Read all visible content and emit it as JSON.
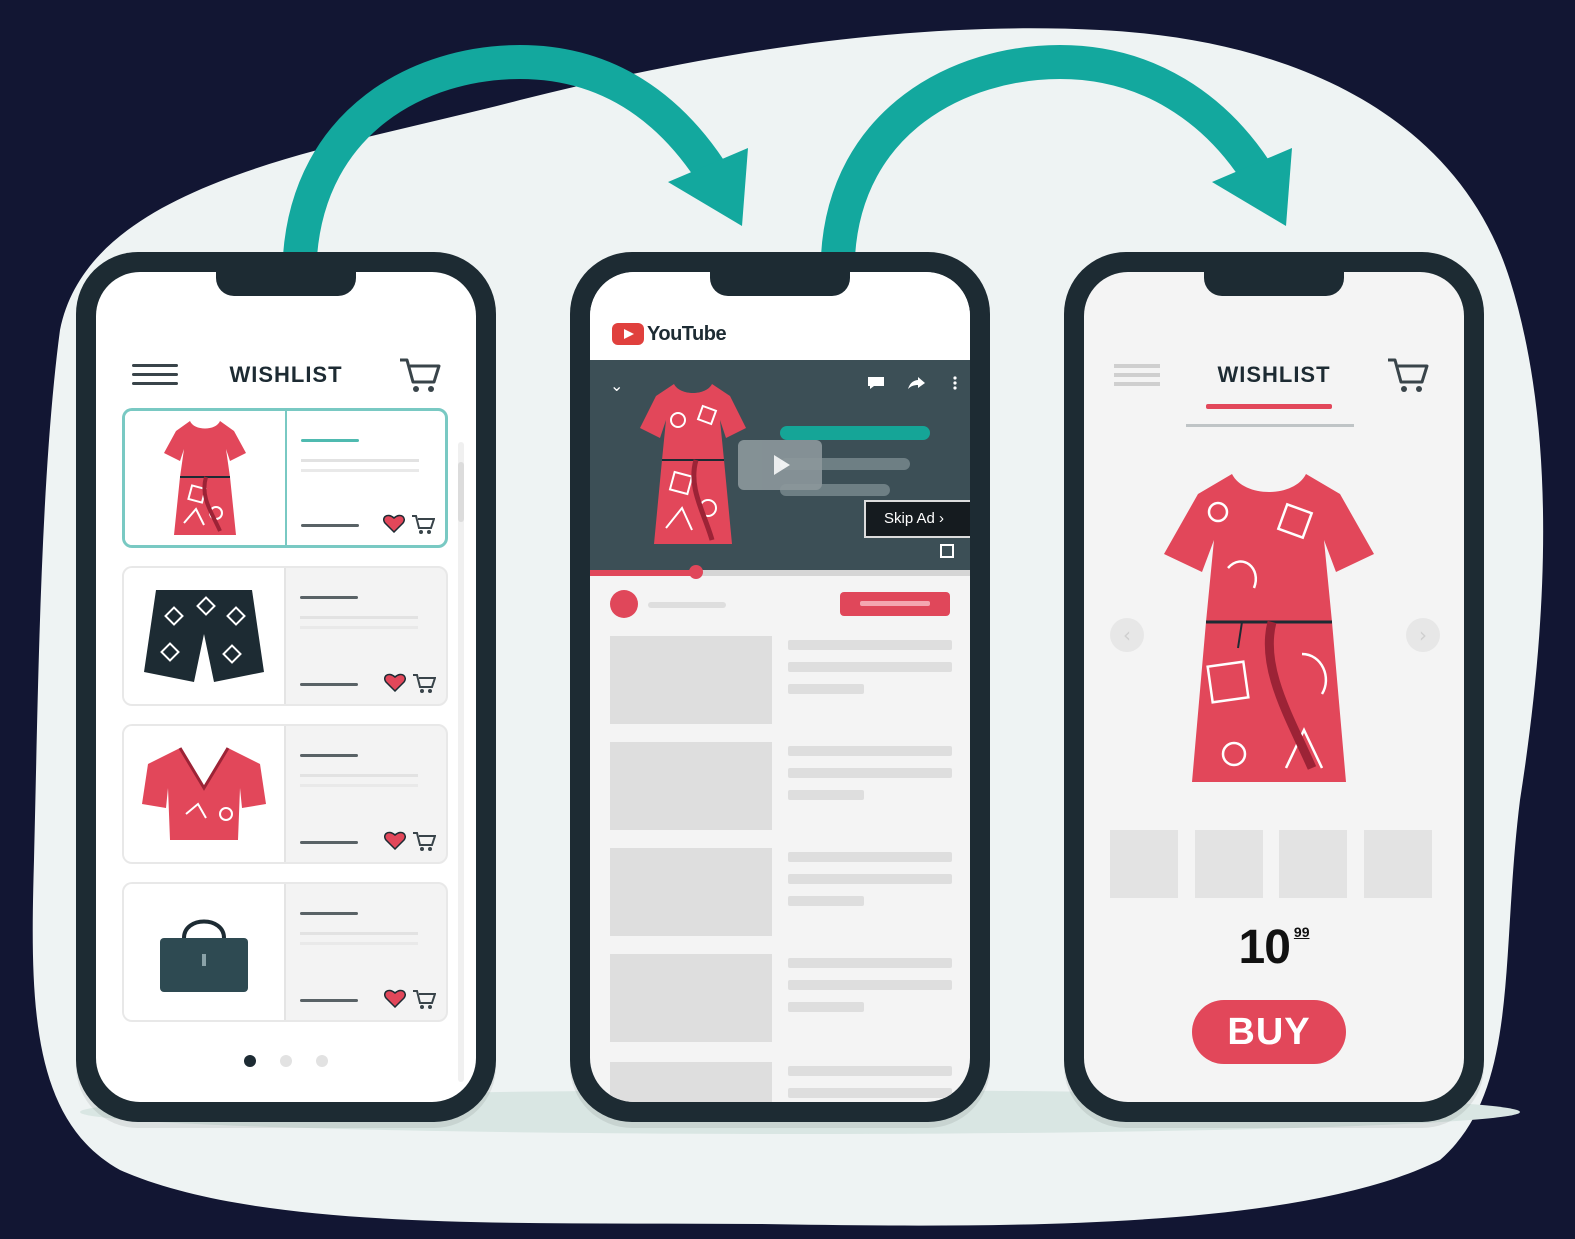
{
  "colors": {
    "background": "#121633",
    "blob": "#eef3f3",
    "arrow": "#13a89e",
    "phone_frame": "#1d2b33",
    "accent_red": "#e2475a",
    "accent_teal": "#79c9c3"
  },
  "wishlist_screen": {
    "title": "WISHLIST",
    "items": [
      {
        "icon": "dress-icon",
        "selected": true
      },
      {
        "icon": "shorts-icon",
        "selected": false
      },
      {
        "icon": "blouse-icon",
        "selected": false
      },
      {
        "icon": "handbag-icon",
        "selected": false
      }
    ],
    "pagination": {
      "pages": 3,
      "current": 1
    }
  },
  "youtube_screen": {
    "logo_text": "YouTube",
    "skip_ad": "Skip Ad ›",
    "progress": 0.28,
    "related_count": 5
  },
  "product_screen": {
    "title": "WISHLIST",
    "price_main": "10",
    "price_cents": "99",
    "buy_label": "BUY",
    "thumbnail_count": 4,
    "prev_arrow": "‹",
    "next_arrow": "›"
  }
}
